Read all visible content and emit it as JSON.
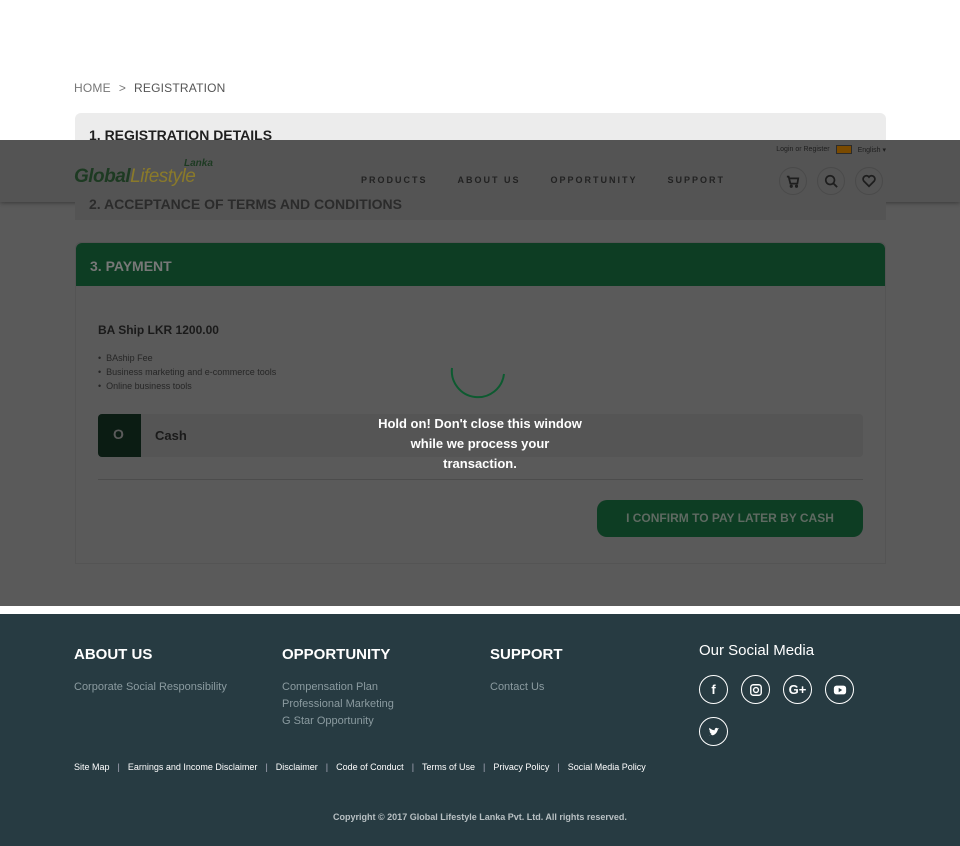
{
  "breadcrumb": {
    "home": "HOME",
    "sep": ">",
    "current": "REGISTRATION"
  },
  "sections": {
    "registration": "1. REGISTRATION DETAILS",
    "terms": "2. ACCEPTANCE OF TERMS AND CONDITIONS",
    "payment": "3. PAYMENT"
  },
  "header": {
    "logo_main": "Global",
    "logo_lifestyle": "Lifestyle",
    "logo_lanka": "Lanka",
    "login": "Login or Register",
    "language": "English ▾",
    "nav": [
      "PRODUCTS",
      "ABOUT US",
      "OPPORTUNITY",
      "SUPPORT"
    ]
  },
  "payment": {
    "plan_title": "BA Ship LKR 1200.00",
    "features": [
      "BAship Fee",
      "Business marketing and e-commerce tools",
      "Online business tools"
    ],
    "option_label": "Cash",
    "option_marker": "O",
    "confirm_button": "I CONFIRM TO PAY LATER BY CASH"
  },
  "overlay": {
    "message_line1": "Hold on! Don't close this window",
    "message_line2": "while we process your",
    "message_line3": "transaction."
  },
  "footer": {
    "about_title": "ABOUT US",
    "about_links": [
      "Corporate Social Responsibility"
    ],
    "opportunity_title": "OPPORTUNITY",
    "opportunity_links": [
      "Compensation Plan",
      "Professional Marketing",
      "G Star Opportunity"
    ],
    "support_title": "SUPPORT",
    "support_links": [
      "Contact Us"
    ],
    "social_title": "Our Social Media",
    "bottom_links": [
      "Site Map",
      "Earnings and Income Disclaimer",
      "Disclaimer",
      "Code of Conduct",
      "Terms of Use",
      "Privacy Policy",
      "Social Media Policy"
    ],
    "copyright": "Copyright © 2017 Global Lifestyle Lanka Pvt. Ltd. All rights reserved."
  },
  "colors": {
    "brand_green": "#0d3d23",
    "footer_bg": "#273b42",
    "overlay_gray": "#5a5a5a"
  },
  "icons": [
    "cart-icon",
    "search-icon",
    "heart-icon",
    "facebook-icon",
    "instagram-icon",
    "google-plus-icon",
    "youtube-icon",
    "twitter-icon",
    "flag-icon"
  ]
}
